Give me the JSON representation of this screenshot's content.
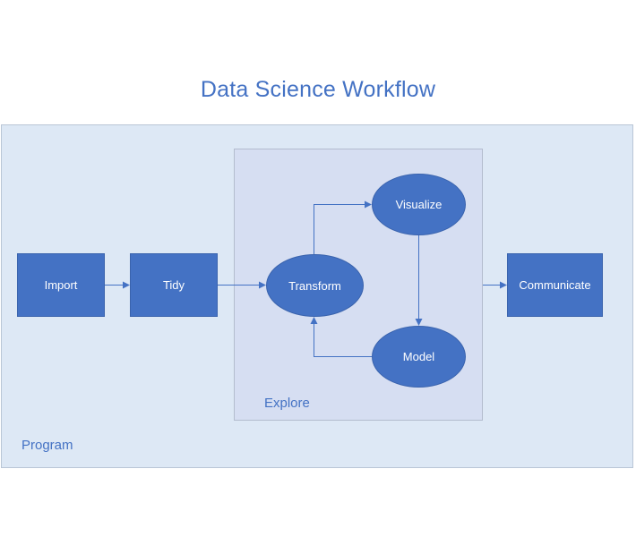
{
  "title": "Data Science Workflow",
  "regions": {
    "program": "Program",
    "explore": "Explore"
  },
  "nodes": {
    "import": "Import",
    "tidy": "Tidy",
    "transform": "Transform",
    "visualize": "Visualize",
    "model": "Model",
    "communicate": "Communicate"
  },
  "colors": {
    "node_fill": "#4472c4",
    "arrow": "#4472c4",
    "program_bg": "#dde8f5",
    "explore_bg": "#d6def2",
    "text_accent": "#4472c4"
  }
}
